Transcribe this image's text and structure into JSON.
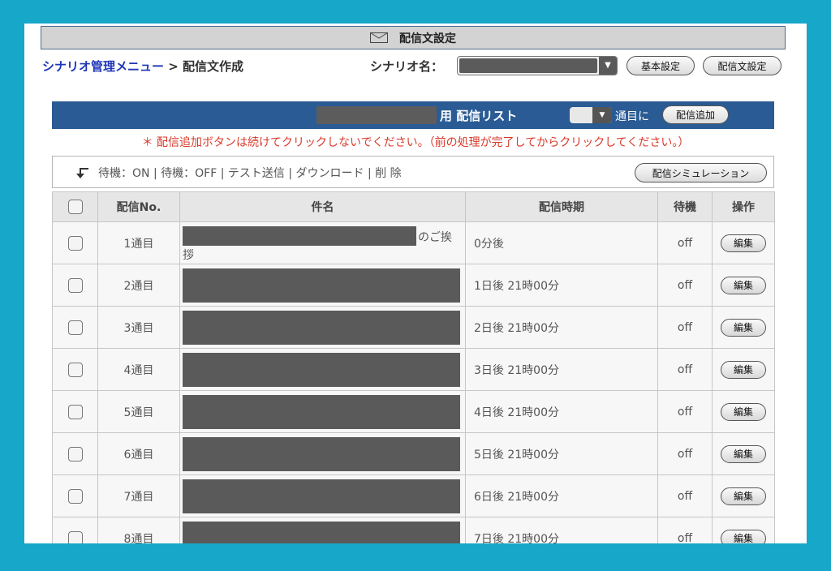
{
  "header": {
    "title": "配信文設定",
    "icon": "mail-icon"
  },
  "breadcrumb": {
    "menu": "シナリオ管理メニュー",
    "separator": " > ",
    "current": "配信文作成"
  },
  "scenario": {
    "label": "シナリオ名：",
    "select_value": ""
  },
  "buttons": {
    "basic_settings": "基本設定",
    "message_settings": "配信文設定",
    "add_delivery": "配信追加",
    "simulation": "配信シミュレーション"
  },
  "list_bar": {
    "title": "用 配信リスト",
    "after_select": "通目に"
  },
  "warning": "＊ 配信追加ボタンは続けてクリックしないでください。（前の処理が完了してからクリックしてください。）",
  "actions": [
    {
      "label": "待機：ON"
    },
    {
      "label": "待機：OFF"
    },
    {
      "label": "テスト送信"
    },
    {
      "label": "ダウンロード"
    },
    {
      "label": "削 除"
    }
  ],
  "table": {
    "headers": {
      "check": "",
      "no": "配信No.",
      "subject": "件名",
      "timing": "配信時期",
      "wait": "待機",
      "op": "操作"
    },
    "rows": [
      {
        "no": "1通目",
        "subject_tail": "のご挨",
        "subject_tail2": "拶",
        "timing": "0分後",
        "wait": "off",
        "op": "編集"
      },
      {
        "no": "2通目",
        "timing": "1日後 21時00分",
        "wait": "off",
        "op": "編集"
      },
      {
        "no": "3通目",
        "timing": "2日後 21時00分",
        "wait": "off",
        "op": "編集"
      },
      {
        "no": "4通目",
        "timing": "3日後 21時00分",
        "wait": "off",
        "op": "編集"
      },
      {
        "no": "5通目",
        "timing": "4日後 21時00分",
        "wait": "off",
        "op": "編集"
      },
      {
        "no": "6通目",
        "timing": "5日後 21時00分",
        "wait": "off",
        "op": "編集"
      },
      {
        "no": "7通目",
        "timing": "6日後 21時00分",
        "wait": "off",
        "op": "編集"
      },
      {
        "no": "8通目",
        "timing": "7日後 21時00分",
        "wait": "off",
        "op": "編集"
      }
    ]
  },
  "colors": {
    "background": "#16a7c9",
    "list_bar": "#2a5b94",
    "warning": "#d93a2a",
    "link": "#1f37b7"
  }
}
